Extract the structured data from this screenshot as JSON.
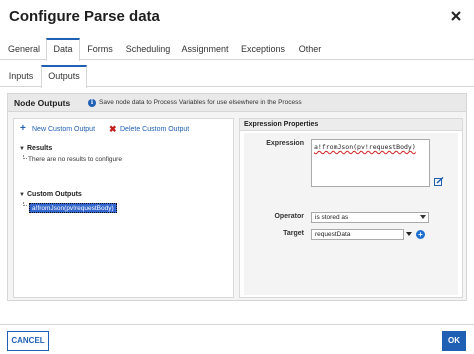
{
  "dialog": {
    "title": "Configure Parse data"
  },
  "tabs": [
    {
      "label": "General"
    },
    {
      "label": "Data"
    },
    {
      "label": "Forms"
    },
    {
      "label": "Scheduling"
    },
    {
      "label": "Assignment"
    },
    {
      "label": "Exceptions"
    },
    {
      "label": "Other"
    }
  ],
  "active_tab": "Data",
  "subtabs": [
    {
      "label": "Inputs"
    },
    {
      "label": "Outputs"
    }
  ],
  "active_subtab": "Outputs",
  "node_outputs": {
    "title": "Node Outputs",
    "info_text": "Save node data to Process Variables for use elsewhere in the Process",
    "new_custom_output": "New Custom Output",
    "delete_custom_output": "Delete Custom Output",
    "results_heading": "Results",
    "results_empty": "There are no results to configure",
    "custom_outputs_heading": "Custom Outputs",
    "custom_outputs": [
      "a!fromJson(pv!requestBody)"
    ]
  },
  "expression_properties": {
    "title": "Expression Properties",
    "expression_label": "Expression",
    "expression_value": "a!fromJson(pv!requestBody)",
    "operator_label": "Operator",
    "operator_value": "is stored as",
    "target_label": "Target",
    "target_value": "requestData"
  },
  "footer": {
    "cancel_label": "CANCEL",
    "ok_label": "OK"
  },
  "colors": {
    "accent": "#1f5fb4",
    "delete": "#c21e1e",
    "selection": "#3366cc"
  },
  "icons": [
    "close-icon",
    "info-icon",
    "plus-icon",
    "delete-x-icon",
    "edit-icon",
    "add-circle-icon",
    "chevron-down-icon"
  ]
}
